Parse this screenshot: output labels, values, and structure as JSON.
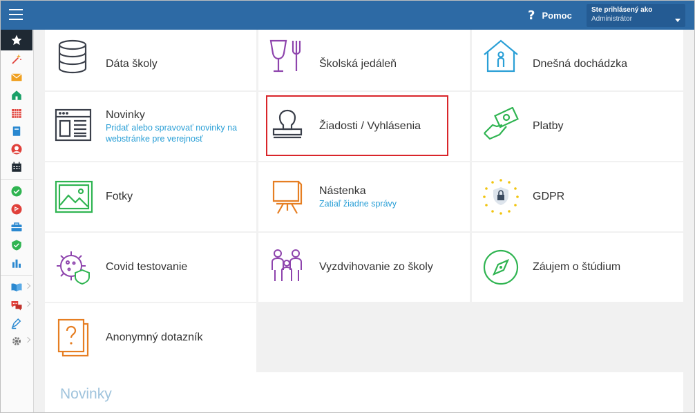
{
  "header": {
    "help_label": "Pomoc",
    "user_line1": "Ste prihlásený ako",
    "user_line2": "Administrátor"
  },
  "sidebar": {
    "items": [
      {
        "icon": "star-icon"
      },
      {
        "icon": "magic-wand-icon"
      },
      {
        "icon": "envelope-icon"
      },
      {
        "icon": "home-icon"
      },
      {
        "icon": "calendar-grid-icon"
      },
      {
        "icon": "book-icon"
      },
      {
        "icon": "user-icon"
      },
      {
        "icon": "schedule-icon"
      },
      {
        "icon": "check-circle-icon"
      },
      {
        "icon": "flag-circle-icon"
      },
      {
        "icon": "briefcase-icon"
      },
      {
        "icon": "shield-check-icon"
      },
      {
        "icon": "bar-chart-icon"
      },
      {
        "icon": "open-book-icon"
      },
      {
        "icon": "chat-bubbles-icon"
      },
      {
        "icon": "pen-icon"
      },
      {
        "icon": "gear-icon"
      }
    ]
  },
  "tiles": [
    {
      "title": "Dáta školy",
      "sub": "",
      "icon": "database-icon"
    },
    {
      "title": "Školská jedáleň",
      "sub": "",
      "icon": "cutlery-icon"
    },
    {
      "title": "Dnešná dochádzka",
      "sub": "",
      "icon": "house-person-icon"
    },
    {
      "title": "Novinky",
      "sub": "Pridať alebo spravovať novinky na webstránke pre verejnosť",
      "icon": "newspaper-icon"
    },
    {
      "title": "Žiadosti / Vyhlásenia",
      "sub": "",
      "icon": "stamp-icon"
    },
    {
      "title": "Platby",
      "sub": "",
      "icon": "money-hand-icon"
    },
    {
      "title": "Fotky",
      "sub": "",
      "icon": "picture-icon"
    },
    {
      "title": "Nástenka",
      "sub": "Zatiaľ žiadne správy",
      "icon": "easel-icon"
    },
    {
      "title": "GDPR",
      "sub": "",
      "icon": "gdpr-lock-icon"
    },
    {
      "title": "Covid testovanie",
      "sub": "",
      "icon": "virus-shield-icon"
    },
    {
      "title": "Vyzdvihovanie zo školy",
      "sub": "",
      "icon": "family-icon"
    },
    {
      "title": "Záujem o štúdium",
      "sub": "",
      "icon": "compass-icon"
    },
    {
      "title": "Anonymný dotazník",
      "sub": "",
      "icon": "question-document-icon"
    }
  ],
  "news": {
    "title": "Novinky"
  },
  "colors": {
    "topbar": "#2d6aa5",
    "highlight": "#d9252a",
    "link": "#2a9fd6"
  }
}
